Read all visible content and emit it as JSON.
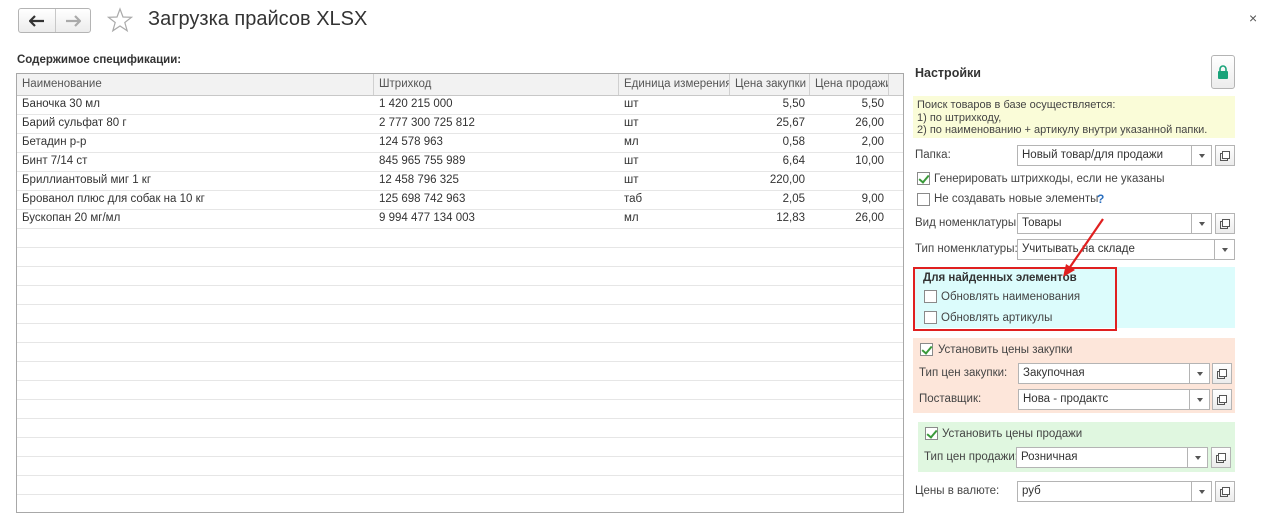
{
  "window": {
    "title": "Загрузка прайсов XLSX",
    "close_symbol": "×"
  },
  "icons": {
    "back": "arrow-left-icon",
    "forward": "arrow-right-icon",
    "favorite": "star-icon",
    "lock": "lock-icon"
  },
  "spec": {
    "label": "Содержимое спецификации:",
    "columns": [
      "Наименование",
      "Штрихкод",
      "Единица измерения",
      "Цена закупки",
      "Цена продажи"
    ],
    "rows": [
      [
        "Баночка 30 мл",
        "1 420 215 000",
        "шт",
        "5,50",
        "5,50"
      ],
      [
        "Барий сульфат 80 г",
        "2 777 300 725 812",
        "шт",
        "25,67",
        "26,00"
      ],
      [
        "Бетадин р-р",
        "124 578 963",
        "мл",
        "0,58",
        "2,00"
      ],
      [
        "Бинт 7/14 ст",
        "845 965 755 989",
        "шт",
        "6,64",
        "10,00"
      ],
      [
        "Бриллиантовый миг 1 кг",
        "12 458 796 325",
        "шт",
        "220,00",
        ""
      ],
      [
        "Брованол плюс для собак на 10 кг",
        "125 698 742 963",
        "таб",
        "2,05",
        "9,00"
      ],
      [
        "Бускопан 20 мг/мл",
        "9 994 477 134 003",
        "мл",
        "12,83",
        "26,00"
      ]
    ]
  },
  "settings": {
    "title": "Настройки",
    "info_lines": [
      "Поиск товаров в базе осуществляется:",
      "1) по штрихкоду,",
      "2) по наименованию + артикулу внутри указанной папки."
    ],
    "folder_label": "Папка:",
    "folder_value": "Новый товар/для продажи",
    "gen_barcodes_label": "Генерировать штрихкоды, если не указаны",
    "gen_barcodes_checked": true,
    "no_new_label": "Не создавать новые элементы",
    "no_new_checked": false,
    "help_symbol": "?",
    "nom_kind_label": "Вид номенклатуры:",
    "nom_kind_value": "Товары",
    "nom_type_label": "Тип номенклатуры:",
    "nom_type_value": "Учитывать на складе",
    "found": {
      "title": "Для найденных элементов",
      "update_names_label": "Обновлять наименования",
      "update_names_checked": false,
      "update_articles_label": "Обновлять артикулы",
      "update_articles_checked": false
    },
    "purchase": {
      "set_label": "Установить цены закупки",
      "set_checked": true,
      "price_type_label": "Тип цен закупки:",
      "price_type_value": "Закупочная",
      "supplier_label": "Поставщик:",
      "supplier_value": "Нова - продактс"
    },
    "sale": {
      "set_label": "Установить цены продажи",
      "set_checked": true,
      "price_type_label": "Тип цен продажи:",
      "price_type_value": "Розничная"
    },
    "currency_label": "Цены в валюте:",
    "currency_value": "руб"
  },
  "colors": {
    "info_bg": "#fafcd8",
    "found_bg": "#dcfcfc",
    "purchase_bg": "#fde6da",
    "sale_bg": "#e0f7e0",
    "annotation_red": "#e02020",
    "lock_green": "#1aa37a"
  }
}
